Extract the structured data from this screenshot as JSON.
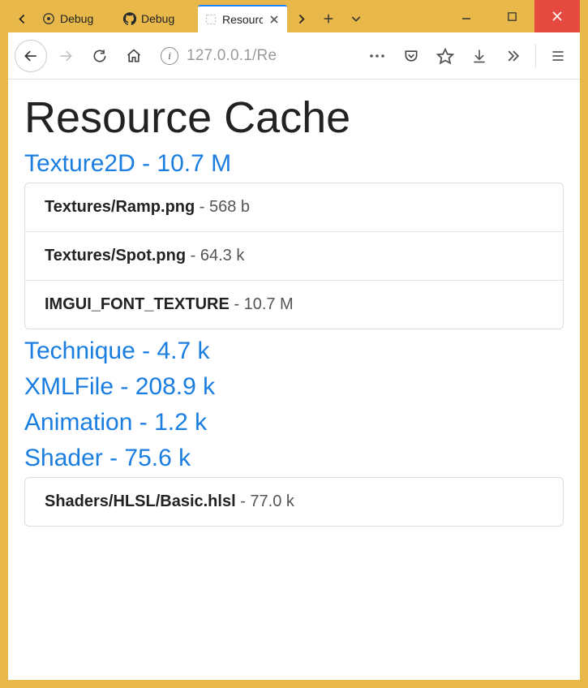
{
  "window": {
    "tabs": [
      {
        "label": "Debug",
        "icon": "circle-dot"
      },
      {
        "label": "Debug",
        "icon": "github"
      },
      {
        "label": "Resourc",
        "icon": "blank",
        "active": true
      }
    ]
  },
  "toolbar": {
    "url_display": "127.0.0.1/Re"
  },
  "page": {
    "title": "Resource Cache",
    "groups": [
      {
        "name": "Texture2D",
        "size": "10.7 M",
        "items": [
          {
            "path": "Textures/Ramp.png",
            "size": "568 b"
          },
          {
            "path": "Textures/Spot.png",
            "size": "64.3 k"
          },
          {
            "path": "IMGUI_FONT_TEXTURE",
            "size": "10.7 M"
          }
        ]
      },
      {
        "name": "Technique",
        "size": "4.7 k",
        "items": []
      },
      {
        "name": "XMLFile",
        "size": "208.9 k",
        "items": []
      },
      {
        "name": "Animation",
        "size": "1.2 k",
        "items": []
      },
      {
        "name": "Shader",
        "size": "75.6 k",
        "items": [
          {
            "path": "Shaders/HLSL/Basic.hlsl",
            "size": "77.0 k"
          }
        ]
      }
    ]
  }
}
